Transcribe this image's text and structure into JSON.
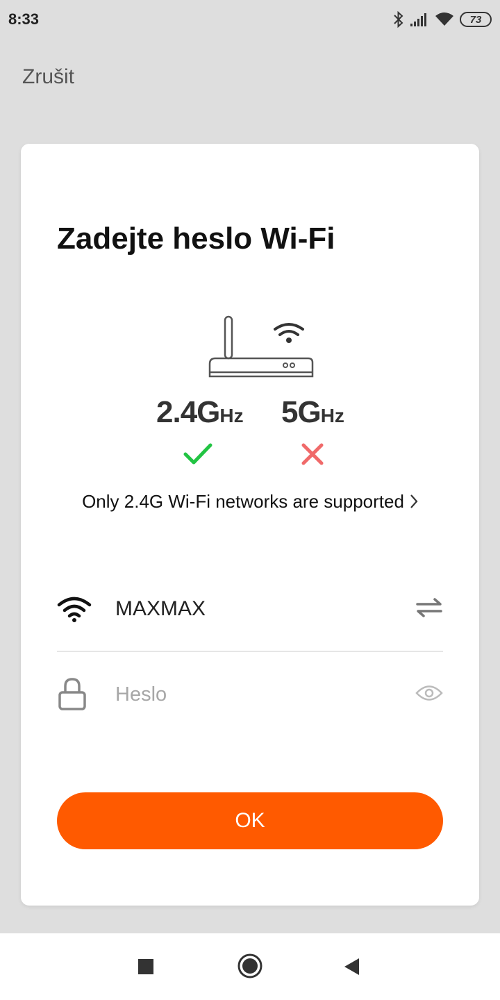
{
  "status_bar": {
    "time": "8:33",
    "battery": "73",
    "icons": [
      "bluetooth-icon",
      "signal-icon",
      "wifi-icon",
      "battery-icon"
    ]
  },
  "header": {
    "cancel_label": "Zrušit"
  },
  "card": {
    "title": "Zadejte heslo Wi-Fi",
    "bands": [
      {
        "value": "2.4G",
        "unit": "Hz",
        "supported": true
      },
      {
        "value": "5G",
        "unit": "Hz",
        "supported": false
      }
    ],
    "support_link": "Only 2.4G Wi-Fi networks are supported",
    "ssid": "MAXMAX",
    "password": {
      "value": "",
      "placeholder": "Heslo"
    },
    "ok_label": "OK"
  },
  "colors": {
    "accent": "#ff5a00",
    "check": "#22c443",
    "cross": "#f06a6a",
    "background": "#dedede"
  }
}
